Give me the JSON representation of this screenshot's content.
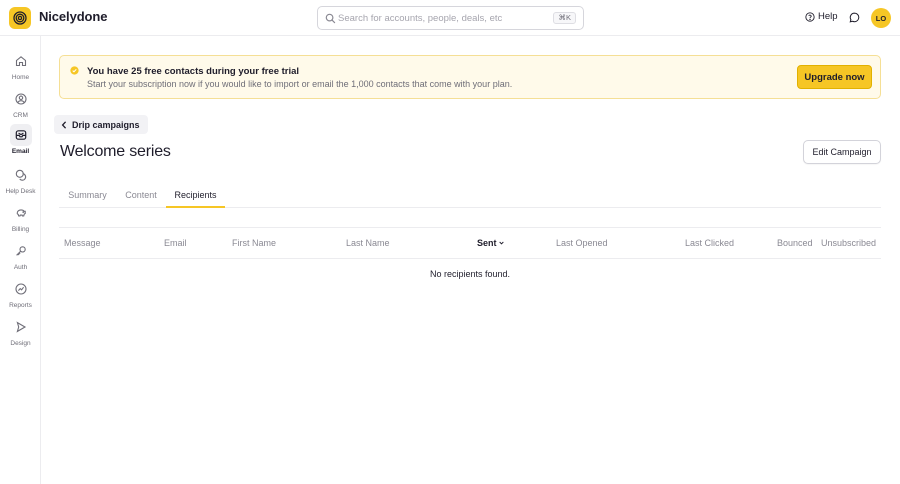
{
  "app": {
    "brand": "Nicelydone"
  },
  "search": {
    "placeholder": "Search for accounts, people, deals, etc",
    "shortcut": "⌘K"
  },
  "header": {
    "help_label": "Help",
    "avatar_initials": "LO"
  },
  "sidebar": {
    "items": [
      {
        "label": "Home",
        "icon": "home-icon",
        "active": false
      },
      {
        "label": "CRM",
        "icon": "person-circle-icon",
        "active": false
      },
      {
        "label": "Email",
        "icon": "mail-icon",
        "active": true
      },
      {
        "label": "Help Desk",
        "icon": "chat-bubbles-icon",
        "active": false
      },
      {
        "label": "Billing",
        "icon": "piggy-bank-icon",
        "active": false
      },
      {
        "label": "Auth",
        "icon": "key-icon",
        "active": false
      },
      {
        "label": "Reports",
        "icon": "chart-icon",
        "active": false
      },
      {
        "label": "Design",
        "icon": "pointer-icon",
        "active": false
      }
    ]
  },
  "banner": {
    "title": "You have 25 free contacts during your free trial",
    "description": "Start your subscription now if you would like to import or email the 1,000 contacts that come with your plan.",
    "button_label": "Upgrade now"
  },
  "page": {
    "back_label": "Drip campaigns",
    "title": "Welcome series",
    "edit_button_label": "Edit Campaign"
  },
  "tabs": [
    {
      "label": "Summary",
      "active": false
    },
    {
      "label": "Content",
      "active": false
    },
    {
      "label": "Recipients",
      "active": true
    }
  ],
  "table": {
    "columns": [
      {
        "label": "Message",
        "sorted": false
      },
      {
        "label": "Email",
        "sorted": false
      },
      {
        "label": "First Name",
        "sorted": false
      },
      {
        "label": "Last Name",
        "sorted": false
      },
      {
        "label": "Sent",
        "sorted": true
      },
      {
        "label": "Last Opened",
        "sorted": false
      },
      {
        "label": "Last Clicked",
        "sorted": false
      },
      {
        "label": "Bounced",
        "sorted": false
      },
      {
        "label": "Unsubscribed",
        "sorted": false
      }
    ],
    "empty_message": "No recipients found."
  },
  "colors": {
    "accent": "#f6c625",
    "banner_bg": "#fffaea",
    "text": "#1f1d2b",
    "muted": "#8a8993"
  }
}
